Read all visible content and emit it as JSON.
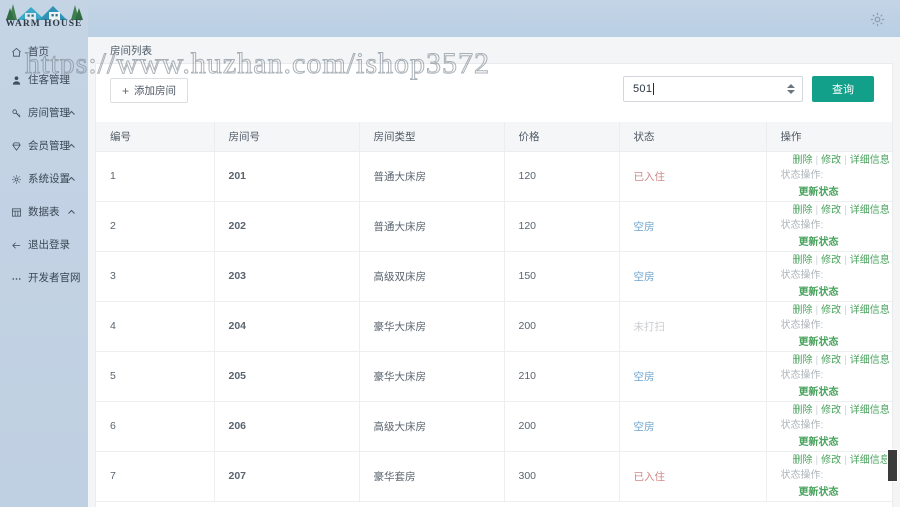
{
  "brand": {
    "logo_text": "WARM HOUSE",
    "logo_icon": "house-trees-logo"
  },
  "topbar": {
    "settings_icon": "gear-icon"
  },
  "sidebar": {
    "items": [
      {
        "label": "首页",
        "icon": "home-icon",
        "caret": false
      },
      {
        "label": "住客管理",
        "icon": "user-icon",
        "caret": false
      },
      {
        "label": "房间管理",
        "icon": "key-icon",
        "caret": true
      },
      {
        "label": "会员管理",
        "icon": "diamond-icon",
        "caret": true
      },
      {
        "label": "系统设置",
        "icon": "gear-icon",
        "caret": true
      },
      {
        "label": "数据表",
        "icon": "table-icon",
        "caret": true
      },
      {
        "label": "退出登录",
        "icon": "logout-arrow-icon",
        "caret": false
      },
      {
        "label": "开发者官网",
        "icon": "ellipsis-icon",
        "caret": false
      }
    ],
    "caret_glyph": "chevron-up-icon"
  },
  "tabs": [
    {
      "label": "房间列表"
    }
  ],
  "toolbar": {
    "add_label": "添加房间",
    "add_icon": "plus-icon",
    "search_value": "501",
    "search_placeholder": "",
    "search_spinner_icon": "spinner-updown-icon",
    "search_button_label": "查询"
  },
  "table": {
    "columns": [
      "编号",
      "房间号",
      "房间类型",
      "价格",
      "状态",
      "操作"
    ],
    "ops": {
      "delete_label": "删除",
      "edit_label": "修改",
      "detail_label": "详细信息",
      "separator": "|",
      "state_op_label": "状态操作:",
      "update_label": "更新状态"
    },
    "rows": [
      {
        "id": "1",
        "room_no": "201",
        "room_type": "普通大床房",
        "price": "120",
        "status": "已入住",
        "status_kind": "occupied"
      },
      {
        "id": "2",
        "room_no": "202",
        "room_type": "普通大床房",
        "price": "120",
        "status": "空房",
        "status_kind": "vacant"
      },
      {
        "id": "3",
        "room_no": "203",
        "room_type": "高级双床房",
        "price": "150",
        "status": "空房",
        "status_kind": "vacant"
      },
      {
        "id": "4",
        "room_no": "204",
        "room_type": "豪华大床房",
        "price": "200",
        "status": "未打扫",
        "status_kind": "dirty"
      },
      {
        "id": "5",
        "room_no": "205",
        "room_type": "豪华大床房",
        "price": "210",
        "status": "空房",
        "status_kind": "vacant"
      },
      {
        "id": "6",
        "room_no": "206",
        "room_type": "高级大床房",
        "price": "200",
        "status": "空房",
        "status_kind": "vacant"
      },
      {
        "id": "7",
        "room_no": "207",
        "room_type": "豪华套房",
        "price": "300",
        "status": "已入住",
        "status_kind": "occupied"
      }
    ]
  },
  "watermark": {
    "text": "https://www.huzhan.com/ishop3572"
  },
  "colors": {
    "sidebar_bg": "#c2d2e3",
    "topbar_bg": "#bdd0e4",
    "accent_teal": "#13a08b",
    "link_green": "#4aa35e",
    "status_occupied": "#d08a8a",
    "status_vacant": "#6ea4cf",
    "status_dirty": "#c9cdd1"
  }
}
